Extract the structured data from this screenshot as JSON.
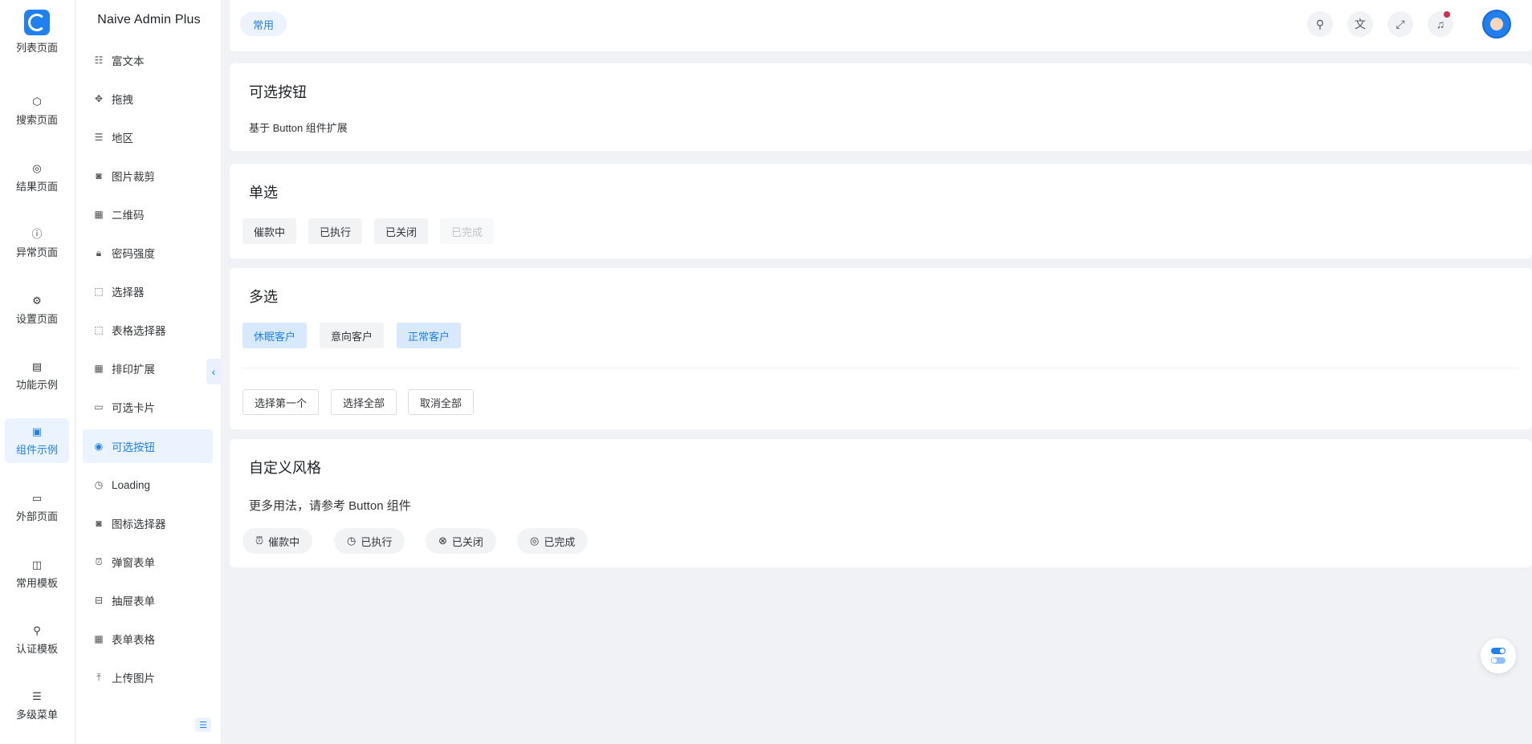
{
  "app": {
    "brand": "Naive Admin Plus"
  },
  "rail": {
    "items": [
      {
        "label": "列表页面",
        "icon": "list-icon"
      },
      {
        "label": "搜索页面",
        "icon": "cube-icon"
      },
      {
        "label": "结果页面",
        "icon": "check-circle-icon"
      },
      {
        "label": "异常页面",
        "icon": "warning-circle-icon"
      },
      {
        "label": "设置页面",
        "icon": "gear-icon"
      },
      {
        "label": "功能示例",
        "icon": "chart-icon"
      },
      {
        "label": "组件示例",
        "icon": "wallet-icon"
      },
      {
        "label": "外部页面",
        "icon": "monitor-icon"
      },
      {
        "label": "常用模板",
        "icon": "layout-icon"
      },
      {
        "label": "认证模板",
        "icon": "key-icon"
      },
      {
        "label": "多级菜单",
        "icon": "menu-icon"
      }
    ]
  },
  "submenu": {
    "items": [
      {
        "label": "富文本",
        "icon": "richtext-icon"
      },
      {
        "label": "拖拽",
        "icon": "drag-icon"
      },
      {
        "label": "地区",
        "icon": "align-icon"
      },
      {
        "label": "图片裁剪",
        "icon": "crop-icon"
      },
      {
        "label": "二维码",
        "icon": "qrcode-icon"
      },
      {
        "label": "密码强度",
        "icon": "lock-icon"
      },
      {
        "label": "选择器",
        "icon": "select-icon"
      },
      {
        "label": "表格选择器",
        "icon": "select-icon"
      },
      {
        "label": "排印扩展",
        "icon": "calendar-icon"
      },
      {
        "label": "可选卡片",
        "icon": "card-icon"
      },
      {
        "label": "可选按钮",
        "icon": "radio-icon"
      },
      {
        "label": "Loading",
        "icon": "clock-icon"
      },
      {
        "label": "图标选择器",
        "icon": "camera-icon"
      },
      {
        "label": "弹窗表单",
        "icon": "alarm-icon"
      },
      {
        "label": "抽屉表单",
        "icon": "inbox-icon"
      },
      {
        "label": "表单表格",
        "icon": "table-icon"
      },
      {
        "label": "上传图片",
        "icon": "upload-icon"
      }
    ]
  },
  "header": {
    "tag": "常用",
    "has_notification": true
  },
  "intro": {
    "title": "可选按钮",
    "desc": "基于 Button 组件扩展"
  },
  "single": {
    "title": "单选",
    "options": [
      "催款中",
      "已执行",
      "已关闭",
      "已完成"
    ]
  },
  "multi": {
    "title": "多选",
    "options": [
      "休眠客户",
      "意向客户",
      "正常客户"
    ],
    "checked": [
      true,
      false,
      true
    ],
    "actions": [
      "选择第一个",
      "选择全部",
      "取消全部"
    ]
  },
  "custom": {
    "title": "自定义风格",
    "desc": "更多用法，请参考 Button 组件",
    "options": [
      "催款中",
      "已执行",
      "已关闭",
      "已完成"
    ]
  },
  "colors": {
    "primary": "#2080f0",
    "bg": "#f0f2f5",
    "badge": "#d03050"
  }
}
